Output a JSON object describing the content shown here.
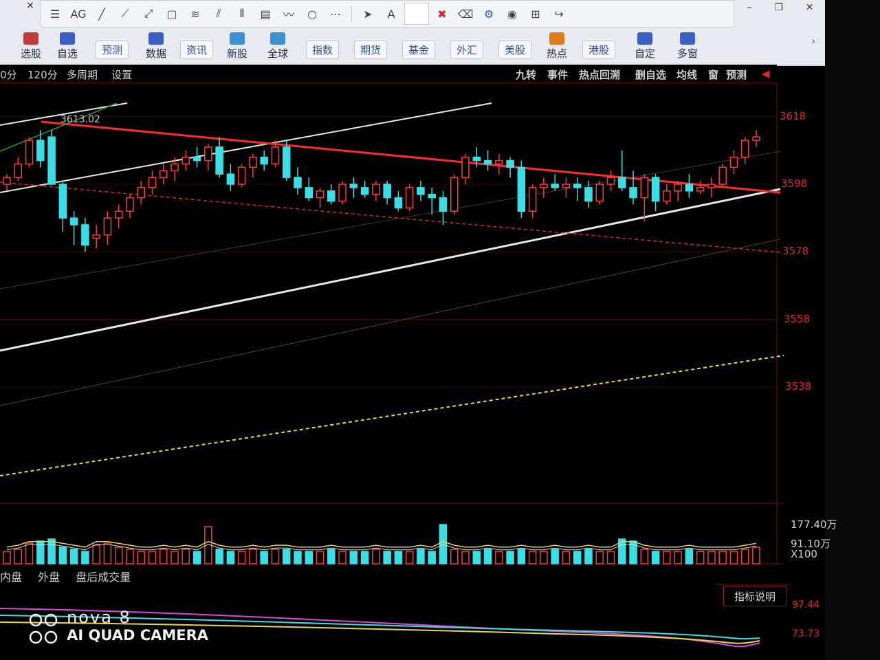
{
  "window": {
    "close_glyph": "×",
    "minimize_glyph": "–",
    "restore_glyph": "❐",
    "winclose_glyph": "✕"
  },
  "draw_tools": {
    "tools": [
      "sliders-icon",
      "ag-icon",
      "line-icon",
      "ray-icon",
      "segment-icon",
      "rect-icon",
      "fan-icon",
      "parallel-icon",
      "vlines-icon",
      "gann-icon",
      "wave-icon",
      "circle-icon",
      "more-icon"
    ],
    "text_tool": "A",
    "actions": [
      "pointer-icon",
      "text-icon",
      "color-swatch",
      "delete-icon",
      "erase-icon",
      "settings-icon",
      "eye-icon",
      "grid-icon",
      "share-icon"
    ]
  },
  "nav": {
    "items": [
      {
        "label": "选股",
        "boxed": false,
        "color": "#c23b3b"
      },
      {
        "label": "自选",
        "boxed": false,
        "color": "#3b5fc2"
      },
      {
        "label": "预测",
        "boxed": true,
        "color": "#3b5fc2"
      },
      {
        "label": "数据",
        "boxed": false,
        "color": "#3b5fc2"
      },
      {
        "label": "资讯",
        "boxed": true,
        "color": "#3b5fc2"
      },
      {
        "label": "新股",
        "boxed": false,
        "color": "#3b8fd2"
      },
      {
        "label": "全球",
        "boxed": false,
        "color": "#3b8fd2"
      },
      {
        "label": "指数",
        "boxed": true,
        "color": "#3b5fc2"
      },
      {
        "label": "期货",
        "boxed": true,
        "color": "#3b5fc2"
      },
      {
        "label": "基金",
        "boxed": true,
        "color": "#3b5fc2"
      },
      {
        "label": "外汇",
        "boxed": true,
        "color": "#3b5fc2"
      },
      {
        "label": "美股",
        "boxed": true,
        "color": "#3b5fc2"
      },
      {
        "label": "热点",
        "boxed": false,
        "color": "#e07a1a"
      },
      {
        "label": "港股",
        "boxed": true,
        "color": "#3b5fc2"
      },
      {
        "label": "自定",
        "boxed": false,
        "color": "#3b5fc2"
      },
      {
        "label": "多窗",
        "boxed": false,
        "color": "#3b5fc2"
      }
    ]
  },
  "period_bar": {
    "p1": "0分",
    "p2": "120分",
    "p3": "多周期",
    "p4": "设置"
  },
  "chart_tools": [
    "九转",
    "事件",
    "热点回溯",
    "删自选",
    "均线",
    "窗",
    "预测"
  ],
  "price_axis": [
    "3618",
    "3598",
    "3578",
    "3558",
    "3538"
  ],
  "max_marker": "3613.02",
  "volume": {
    "top": "177.40万",
    "mid": "91.10万",
    "unit": "X100"
  },
  "volume_tabs": [
    "内盘",
    "外盘",
    "盘后成交量"
  ],
  "indicator_button": "指标说明",
  "indicator_axis": [
    "97.44",
    "73.73"
  ],
  "watermark": {
    "line1": "nova 8",
    "line2": "AI QUAD CAMERA"
  },
  "chart_data": {
    "type": "candlestick",
    "ylim": [
      3528,
      3622
    ],
    "candles": [
      [
        3598,
        3601,
        3596,
        3600
      ],
      [
        3600,
        3606,
        3599,
        3604
      ],
      [
        3604,
        3612,
        3603,
        3611
      ],
      [
        3611,
        3614,
        3603,
        3605
      ],
      [
        3612,
        3614,
        3600,
        3598
      ],
      [
        3598,
        3599,
        3584,
        3588
      ],
      [
        3588,
        3590,
        3580,
        3586
      ],
      [
        3586,
        3588,
        3578,
        3580
      ],
      [
        3582,
        3586,
        3579,
        3583
      ],
      [
        3583,
        3590,
        3580,
        3588
      ],
      [
        3588,
        3592,
        3585,
        3590
      ],
      [
        3590,
        3595,
        3588,
        3594
      ],
      [
        3594,
        3599,
        3592,
        3597
      ],
      [
        3597,
        3602,
        3595,
        3600
      ],
      [
        3600,
        3604,
        3598,
        3602
      ],
      [
        3602,
        3606,
        3599,
        3604
      ],
      [
        3604,
        3608,
        3602,
        3606
      ],
      [
        3606,
        3609,
        3603,
        3605
      ],
      [
        3605,
        3610,
        3602,
        3609
      ],
      [
        3609,
        3612,
        3600,
        3601
      ],
      [
        3601,
        3604,
        3596,
        3598
      ],
      [
        3598,
        3604,
        3597,
        3603
      ],
      [
        3603,
        3607,
        3600,
        3606
      ],
      [
        3606,
        3608,
        3602,
        3604
      ],
      [
        3604,
        3611,
        3603,
        3609
      ],
      [
        3609,
        3611,
        3599,
        3600
      ],
      [
        3600,
        3603,
        3595,
        3597
      ],
      [
        3597,
        3600,
        3593,
        3594
      ],
      [
        3594,
        3597,
        3591,
        3596
      ],
      [
        3596,
        3598,
        3592,
        3593
      ],
      [
        3593,
        3599,
        3592,
        3598
      ],
      [
        3598,
        3600,
        3594,
        3597
      ],
      [
        3597,
        3599,
        3594,
        3595
      ],
      [
        3595,
        3599,
        3593,
        3598
      ],
      [
        3598,
        3599,
        3592,
        3594
      ],
      [
        3594,
        3596,
        3590,
        3591
      ],
      [
        3591,
        3598,
        3590,
        3597
      ],
      [
        3597,
        3599,
        3593,
        3595
      ],
      [
        3595,
        3597,
        3589,
        3594
      ],
      [
        3594,
        3596,
        3586,
        3590
      ],
      [
        3590,
        3601,
        3589,
        3600
      ],
      [
        3600,
        3607,
        3598,
        3606
      ],
      [
        3606,
        3609,
        3603,
        3605
      ],
      [
        3605,
        3608,
        3602,
        3604
      ],
      [
        3604,
        3607,
        3601,
        3605
      ],
      [
        3605,
        3606,
        3600,
        3603
      ],
      [
        3603,
        3605,
        3588,
        3590
      ],
      [
        3590,
        3598,
        3588,
        3597
      ],
      [
        3597,
        3600,
        3594,
        3598
      ],
      [
        3598,
        3601,
        3596,
        3597
      ],
      [
        3597,
        3600,
        3594,
        3598
      ],
      [
        3598,
        3600,
        3593,
        3597
      ],
      [
        3597,
        3599,
        3591,
        3593
      ],
      [
        3593,
        3599,
        3592,
        3598
      ],
      [
        3598,
        3602,
        3596,
        3600
      ],
      [
        3600,
        3608,
        3596,
        3597
      ],
      [
        3597,
        3602,
        3592,
        3594
      ],
      [
        3594,
        3601,
        3587,
        3600
      ],
      [
        3600,
        3601,
        3590,
        3593
      ],
      [
        3593,
        3598,
        3592,
        3596
      ],
      [
        3596,
        3599,
        3593,
        3598
      ],
      [
        3598,
        3601,
        3594,
        3596
      ],
      [
        3596,
        3599,
        3595,
        3597
      ],
      [
        3597,
        3600,
        3594,
        3598
      ],
      [
        3598,
        3604,
        3597,
        3603
      ],
      [
        3603,
        3608,
        3601,
        3606
      ],
      [
        3606,
        3612,
        3604,
        3611
      ],
      [
        3611,
        3614,
        3609,
        3612
      ]
    ],
    "volumes": [
      0.3,
      0.35,
      0.5,
      0.55,
      0.6,
      0.4,
      0.35,
      0.3,
      0.45,
      0.5,
      0.4,
      0.35,
      0.3,
      0.3,
      0.35,
      0.3,
      0.35,
      0.3,
      0.9,
      0.35,
      0.3,
      0.3,
      0.35,
      0.3,
      0.35,
      0.35,
      0.3,
      0.3,
      0.3,
      0.35,
      0.3,
      0.3,
      0.3,
      0.35,
      0.3,
      0.3,
      0.3,
      0.35,
      0.3,
      0.95,
      0.35,
      0.3,
      0.3,
      0.35,
      0.3,
      0.3,
      0.35,
      0.3,
      0.3,
      0.35,
      0.3,
      0.3,
      0.35,
      0.3,
      0.3,
      0.6,
      0.55,
      0.35,
      0.3,
      0.3,
      0.3,
      0.35,
      0.3,
      0.3,
      0.3,
      0.3,
      0.35,
      0.4
    ]
  }
}
